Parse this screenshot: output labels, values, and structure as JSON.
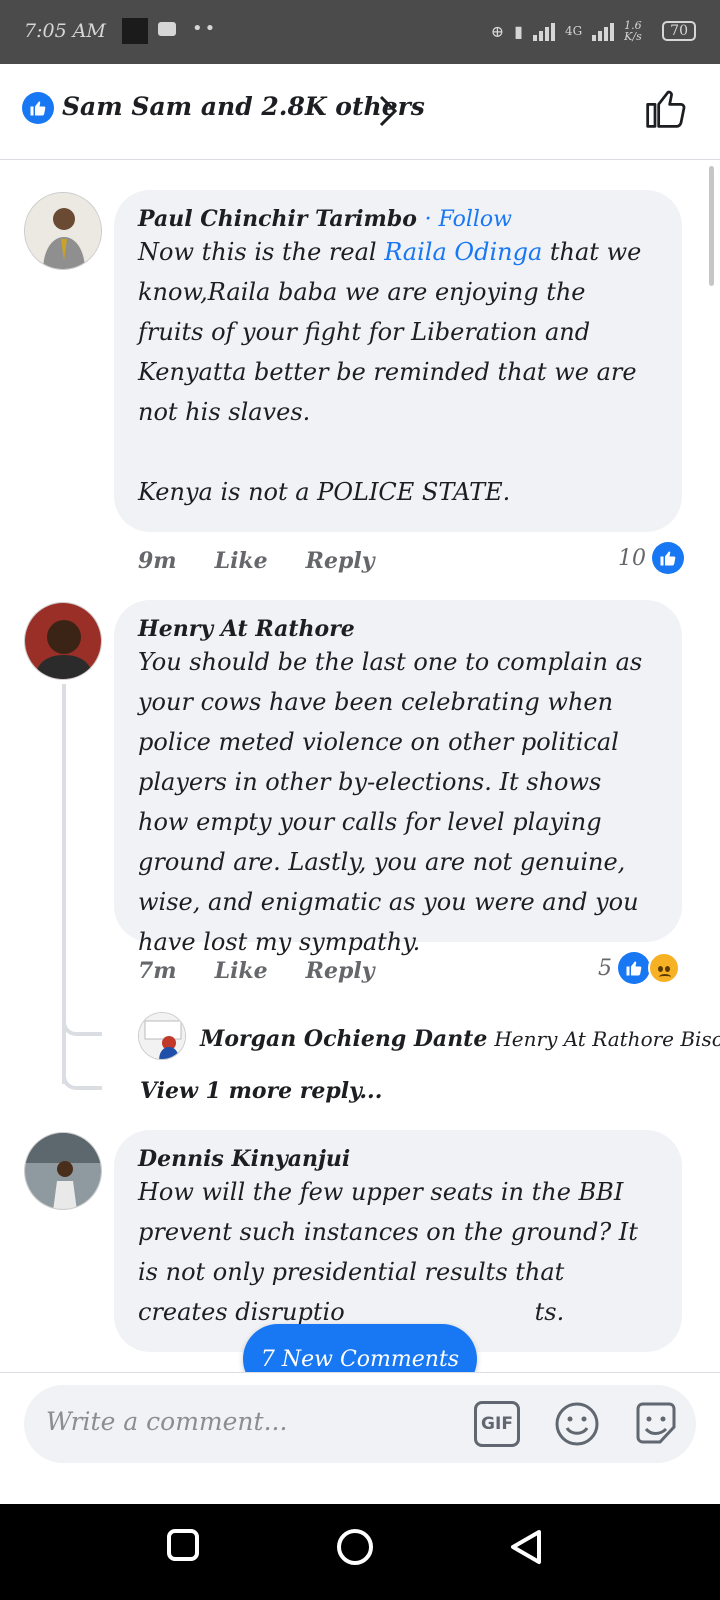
{
  "status_bar": {
    "time": "7:05 AM",
    "network": "4G",
    "speed": "1.6 K/s",
    "battery": "70"
  },
  "header": {
    "reactors_text": "Sam Sam and 2.8K others"
  },
  "comments": [
    {
      "author": "Paul Chinchir Tarimbo",
      "follow_label": "· Follow",
      "text_before": "Now this is the real ",
      "mention": "Raila Odinga",
      "text_after": " that we know,Raila baba we are enjoying the fruits of your fight for Liberation and Kenyatta better be reminded that we are not his slaves.\n\nKenya is not a POLICE STATE.",
      "time": "9m",
      "like_label": "Like",
      "reply_label": "Reply",
      "reaction_count": "10"
    },
    {
      "author": "Henry At Rathore",
      "text": "You should be the last one to complain as your cows have been celebrating when police meted violence on other political players in other by-elections. It shows how empty your calls for level playing ground are. Lastly, you are not genuine, wise, and enigmatic as you were and you have lost my sympathy.",
      "time": "7m",
      "like_label": "Like",
      "reply_label": "Reply",
      "reaction_count": "5"
    },
    {
      "author": "Dennis Kinyanjui",
      "text": "How will the few upper seats in the BBI prevent such instances on the ground? It is not only presidential results that creates disruptio",
      "text_tail": "ts."
    }
  ],
  "reply_preview": {
    "author": "Morgan Ochieng Dante",
    "snippet": "Henry At Rathore  Bisop.....",
    "view_more": "View 1 more reply..."
  },
  "new_comments_label": "7 New Comments",
  "composer": {
    "placeholder": "Write a comment...",
    "gif_label": "GIF"
  },
  "colors": {
    "accent": "#1877f2",
    "bubble": "#f0f2f5",
    "status_bar": "#4b4b4b"
  }
}
